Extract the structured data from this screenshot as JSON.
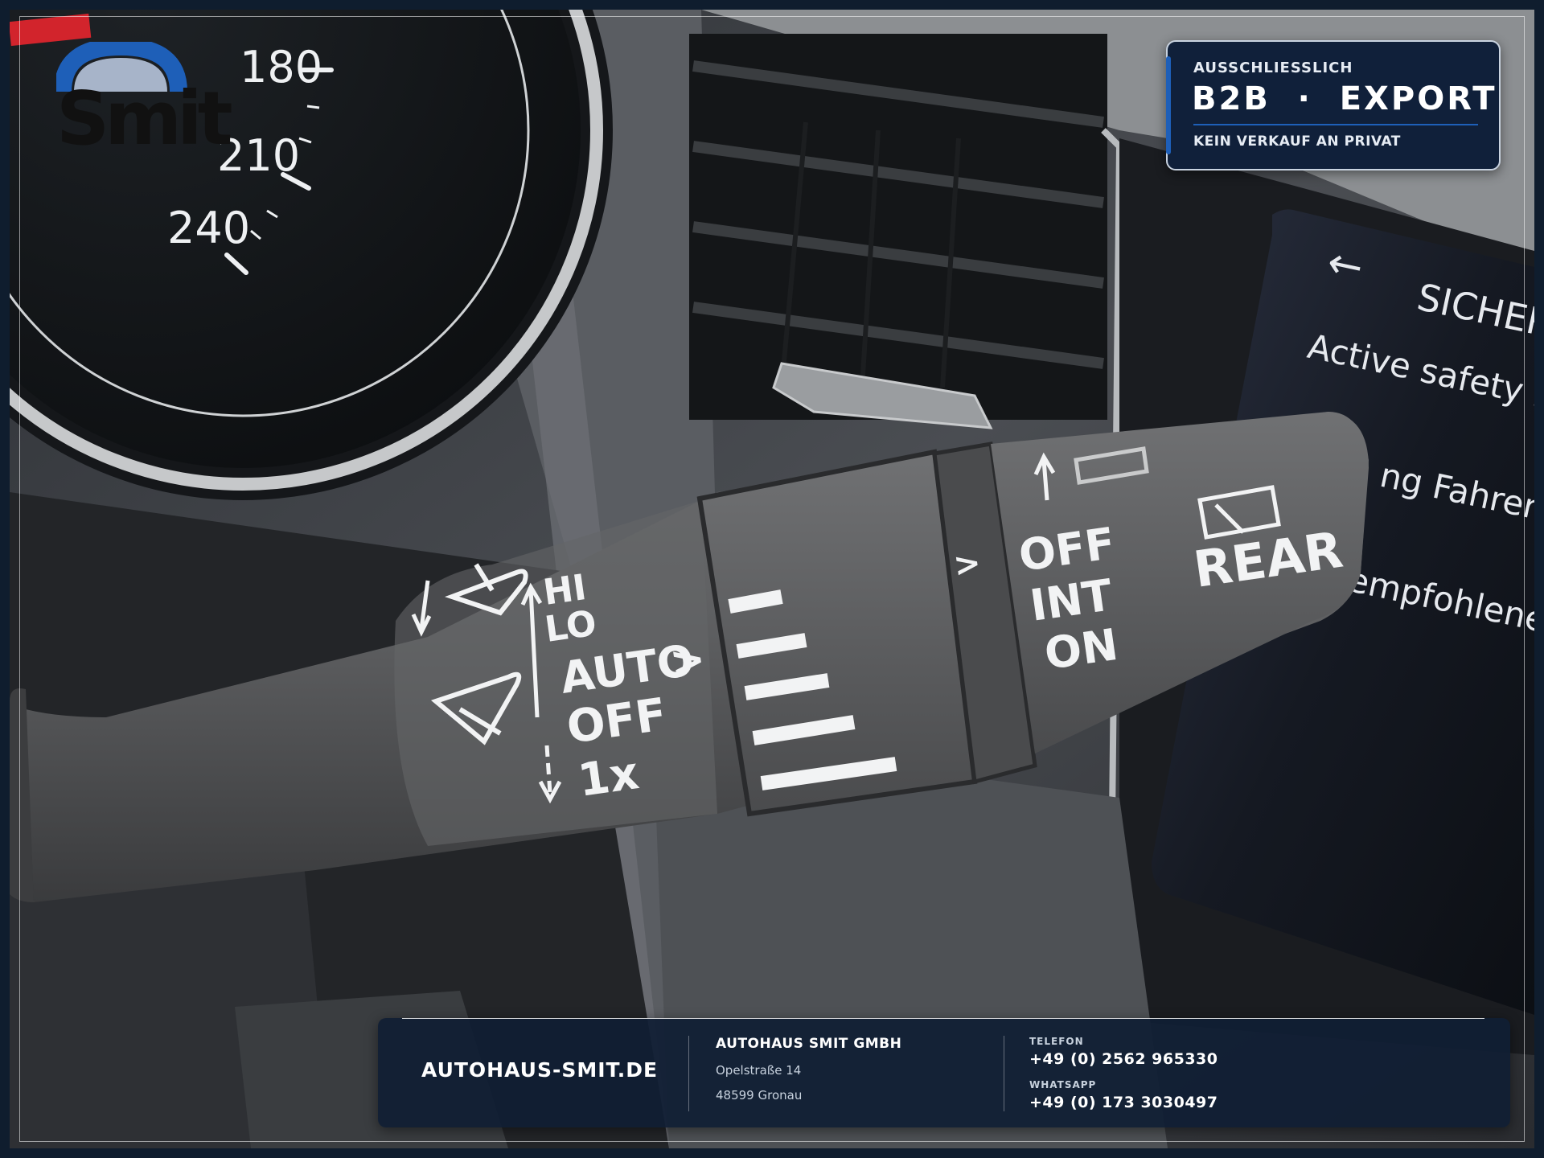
{
  "logo": {
    "text": "Smit",
    "arc_color": "#1e5fb8"
  },
  "badge": {
    "top": "AUSSCHLIESSLICH",
    "main_left": "B2B",
    "separator": "·",
    "main_right": "EXPORT",
    "bottom": "KEIN VERKAUF AN PRIVAT"
  },
  "footer": {
    "website": "AUTOHAUS-SMIT.DE",
    "company": "AUTOHAUS SMIT GMBH",
    "street": "Opelstraße 14",
    "city": "48599 Gronau",
    "phone_label": "TELEFON",
    "phone": "+49 (0) 2562 965330",
    "whatsapp_label": "WHATSAPP",
    "whatsapp": "+49 (0) 173 3030497"
  },
  "photo": {
    "speedo_ticks": [
      "180",
      "210",
      "240"
    ],
    "stalk_front": [
      "HI",
      "LO",
      "AUTO",
      "OFF",
      "1x"
    ],
    "stalk_arrow": ">",
    "stalk_rear": [
      "OFF",
      "INT",
      "ON"
    ],
    "stalk_rear_label": "REAR",
    "screen_back": "←",
    "screen_title": "SICHERH",
    "screen_lines": [
      "Active safety brake",
      "ng Fahreraufmer",
      "empfohlene Ges"
    ]
  }
}
